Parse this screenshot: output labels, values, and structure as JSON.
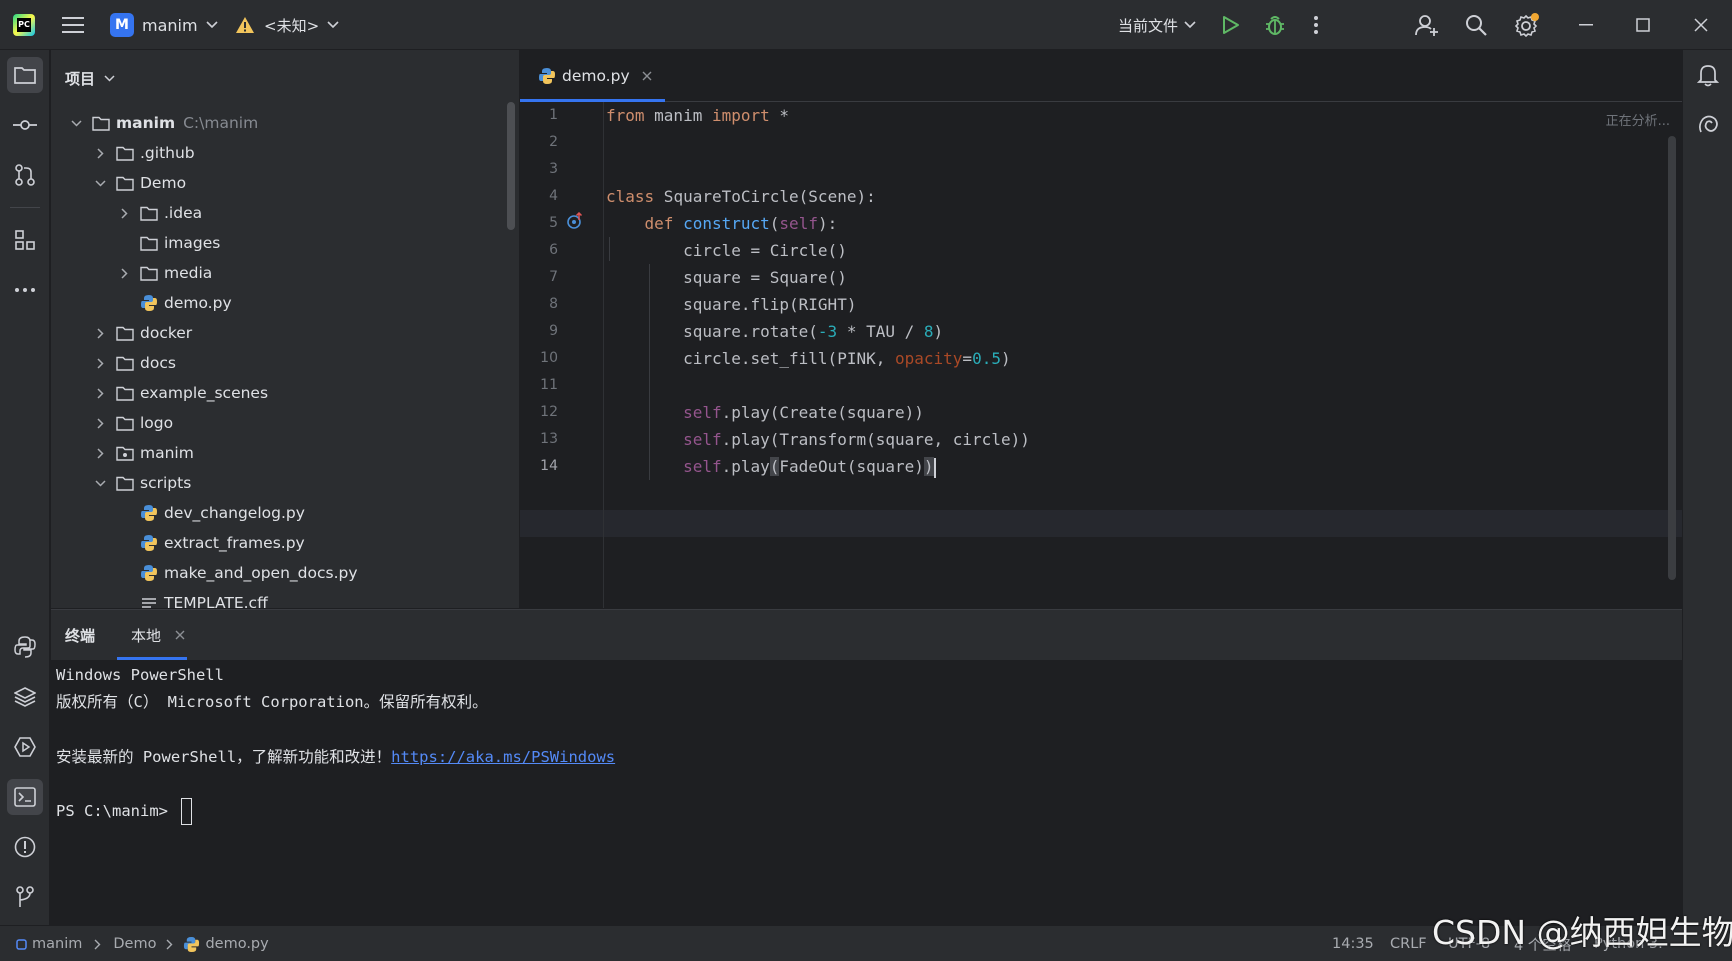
{
  "titlebar": {
    "project_badge": "M",
    "project_name": "manim",
    "vcs_label": "<未知>",
    "run_config": "当前文件"
  },
  "project_panel": {
    "title": "项目",
    "root": {
      "name": "manim",
      "path": "C:\\manim"
    },
    "items": [
      {
        "name": ".github",
        "type": "folder",
        "expanded": false
      },
      {
        "name": "Demo",
        "type": "folder",
        "expanded": true
      },
      {
        "name": ".idea",
        "type": "folder",
        "expanded": false
      },
      {
        "name": "images",
        "type": "folder",
        "expanded": false
      },
      {
        "name": "media",
        "type": "folder",
        "expanded": false
      },
      {
        "name": "demo.py",
        "type": "python"
      },
      {
        "name": "docker",
        "type": "folder",
        "expanded": false
      },
      {
        "name": "docs",
        "type": "folder",
        "expanded": false
      },
      {
        "name": "example_scenes",
        "type": "folder",
        "expanded": false
      },
      {
        "name": "logo",
        "type": "folder",
        "expanded": false
      },
      {
        "name": "manim",
        "type": "package",
        "expanded": false
      },
      {
        "name": "scripts",
        "type": "folder",
        "expanded": true
      },
      {
        "name": "dev_changelog.py",
        "type": "python"
      },
      {
        "name": "extract_frames.py",
        "type": "python"
      },
      {
        "name": "make_and_open_docs.py",
        "type": "python"
      },
      {
        "name": "TEMPLATE.cff",
        "type": "text"
      }
    ]
  },
  "editor": {
    "tab_label": "demo.py",
    "status": "正在分析...",
    "line_numbers": [
      "1",
      "2",
      "3",
      "4",
      "5",
      "6",
      "7",
      "8",
      "9",
      "10",
      "11",
      "12",
      "13",
      "14"
    ],
    "current_line": "14"
  },
  "terminal": {
    "tab_title": "终端",
    "session_tab": "本地",
    "lines": [
      "Windows PowerShell",
      "版权所有（C） Microsoft Corporation。保留所有权利。",
      "",
      "安装最新的 PowerShell，了解新功能和改进！"
    ],
    "link": "https://aka.ms/PSWindows",
    "prompt": "PS C:\\manim> "
  },
  "statusbar": {
    "breadcrumb": [
      "manim",
      "Demo",
      "demo.py"
    ],
    "position": "14:35",
    "line_ending": "CRLF",
    "encoding": "UTF-8",
    "indent": "4 个空格",
    "interpreter": "Python 3."
  },
  "watermark": "CSDN @纳西妲生物",
  "colors": {
    "accent": "#3574f0",
    "keyword": "#cf8e6d",
    "function": "#56a8f5",
    "self": "#94558d",
    "number": "#2aacb8",
    "param": "#aa4926",
    "run_green": "#5fb865"
  }
}
